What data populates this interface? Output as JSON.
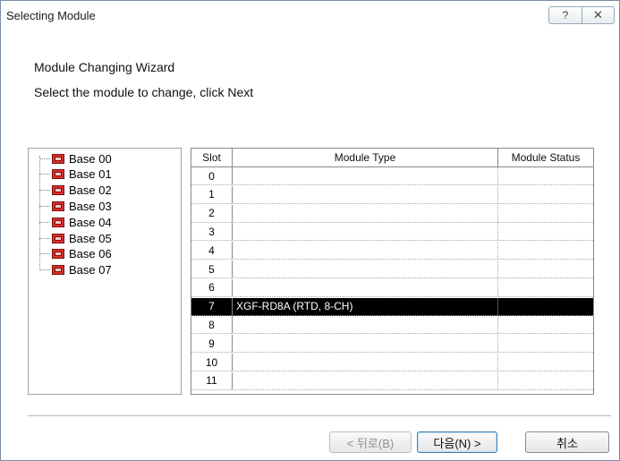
{
  "window": {
    "title": "Selecting Module",
    "help_symbol": "?",
    "close_symbol": "☒"
  },
  "wizard": {
    "heading": "Module Changing Wizard",
    "instruction": "Select the module to change, click Next"
  },
  "tree": {
    "items": [
      {
        "label": "Base 00"
      },
      {
        "label": "Base 01"
      },
      {
        "label": "Base 02"
      },
      {
        "label": "Base 03"
      },
      {
        "label": "Base 04"
      },
      {
        "label": "Base 05"
      },
      {
        "label": "Base 06"
      },
      {
        "label": "Base 07"
      }
    ]
  },
  "grid": {
    "columns": {
      "slot": "Slot",
      "type": "Module Type",
      "status": "Module Status"
    },
    "rows": [
      {
        "slot": "0",
        "type": "",
        "status": ""
      },
      {
        "slot": "1",
        "type": "",
        "status": ""
      },
      {
        "slot": "2",
        "type": "",
        "status": ""
      },
      {
        "slot": "3",
        "type": "",
        "status": ""
      },
      {
        "slot": "4",
        "type": "",
        "status": ""
      },
      {
        "slot": "5",
        "type": "",
        "status": ""
      },
      {
        "slot": "6",
        "type": "",
        "status": ""
      },
      {
        "slot": "7",
        "type": "XGF-RD8A (RTD, 8-CH)",
        "status": ""
      },
      {
        "slot": "8",
        "type": "",
        "status": ""
      },
      {
        "slot": "9",
        "type": "",
        "status": ""
      },
      {
        "slot": "10",
        "type": "",
        "status": ""
      },
      {
        "slot": "11",
        "type": "",
        "status": ""
      }
    ],
    "selected_slot": "7"
  },
  "buttons": {
    "back": "< 뒤로(B)",
    "next": "다음(N) >",
    "cancel": "취소"
  },
  "colors": {
    "selection_bg": "#000000",
    "selection_fg": "#ffffff",
    "base_icon": "#d9302a"
  }
}
